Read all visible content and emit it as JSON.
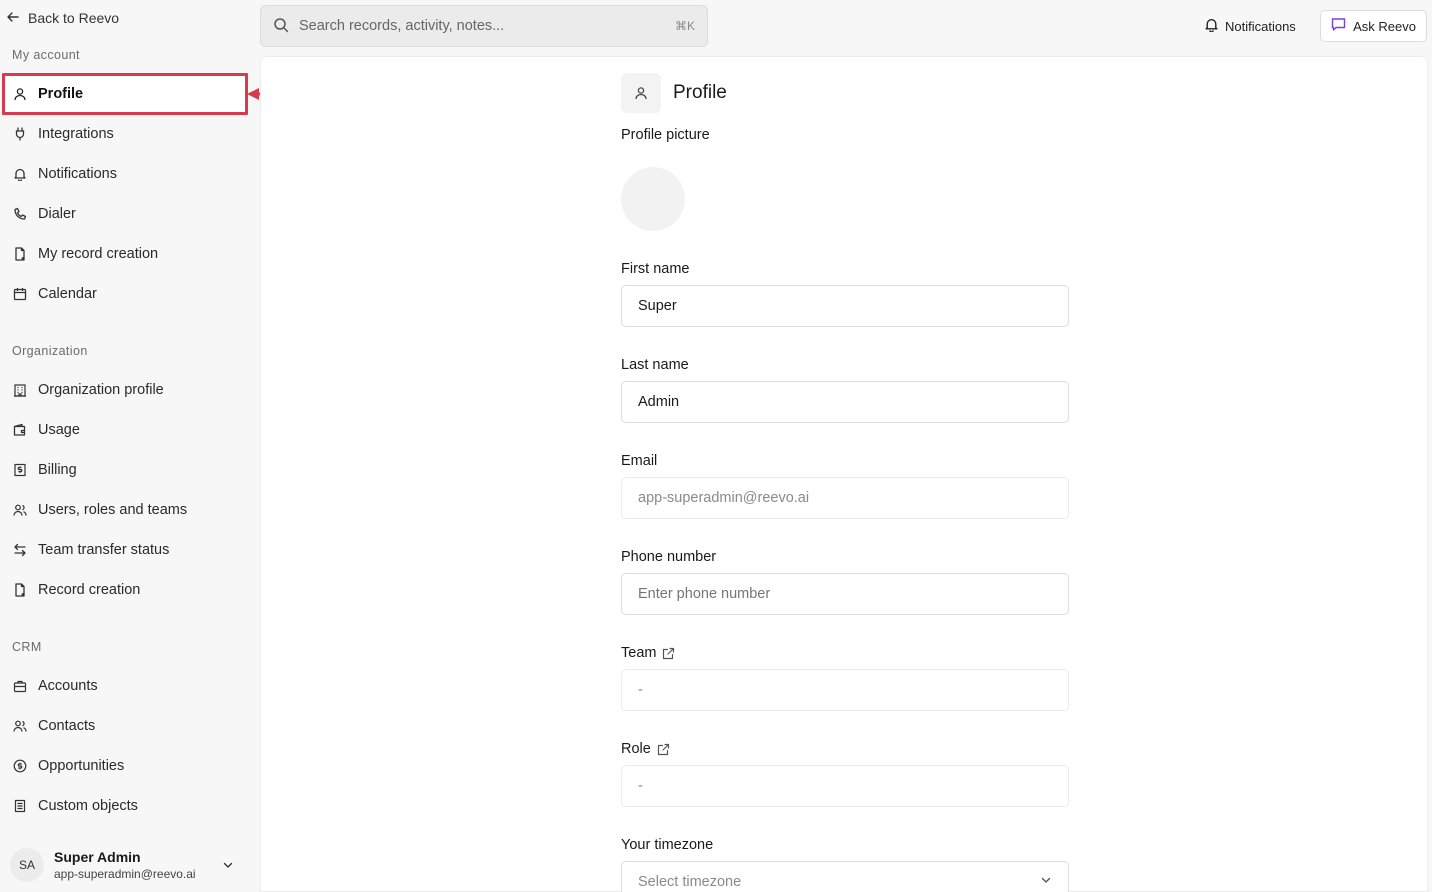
{
  "sidebar": {
    "back_label": "Back to Reevo",
    "sections": {
      "my_account": "My account",
      "organization": "Organization",
      "crm": "CRM"
    },
    "my_account_items": [
      {
        "label": "Profile",
        "icon": "user-icon",
        "active": true
      },
      {
        "label": "Integrations",
        "icon": "plug-icon"
      },
      {
        "label": "Notifications",
        "icon": "bell-icon"
      },
      {
        "label": "Dialer",
        "icon": "phone-icon"
      },
      {
        "label": "My record creation",
        "icon": "file-plus-icon"
      },
      {
        "label": "Calendar",
        "icon": "calendar-icon"
      }
    ],
    "organization_items": [
      {
        "label": "Organization profile",
        "icon": "building-icon"
      },
      {
        "label": "Usage",
        "icon": "wallet-icon"
      },
      {
        "label": "Billing",
        "icon": "receipt-icon"
      },
      {
        "label": "Users, roles and teams",
        "icon": "users-icon"
      },
      {
        "label": "Team transfer status",
        "icon": "arrows-swap-icon"
      },
      {
        "label": "Record creation",
        "icon": "file-plus-icon"
      }
    ],
    "crm_items": [
      {
        "label": "Accounts",
        "icon": "briefcase-icon"
      },
      {
        "label": "Contacts",
        "icon": "users-icon"
      },
      {
        "label": "Opportunities",
        "icon": "dollar-circle-icon"
      },
      {
        "label": "Custom objects",
        "icon": "document-icon"
      }
    ],
    "user": {
      "initials": "SA",
      "name": "Super Admin",
      "email": "app-superadmin@reevo.ai"
    }
  },
  "topbar": {
    "search_placeholder": "Search records, activity, notes...",
    "search_shortcut": "⌘K",
    "notifications_label": "Notifications",
    "ask_label": "Ask Reevo"
  },
  "profile": {
    "title": "Profile",
    "picture_label": "Profile picture",
    "first_name_label": "First name",
    "first_name_value": "Super",
    "last_name_label": "Last name",
    "last_name_value": "Admin",
    "email_label": "Email",
    "email_value": "app-superadmin@reevo.ai",
    "phone_label": "Phone number",
    "phone_placeholder": "Enter phone number",
    "team_label": "Team",
    "team_value": "-",
    "role_label": "Role",
    "role_value": "-",
    "timezone_label": "Your timezone",
    "timezone_placeholder": "Select timezone"
  },
  "colors": {
    "highlight": "#d83a4e",
    "ask_icon": "#7b3fe4"
  }
}
